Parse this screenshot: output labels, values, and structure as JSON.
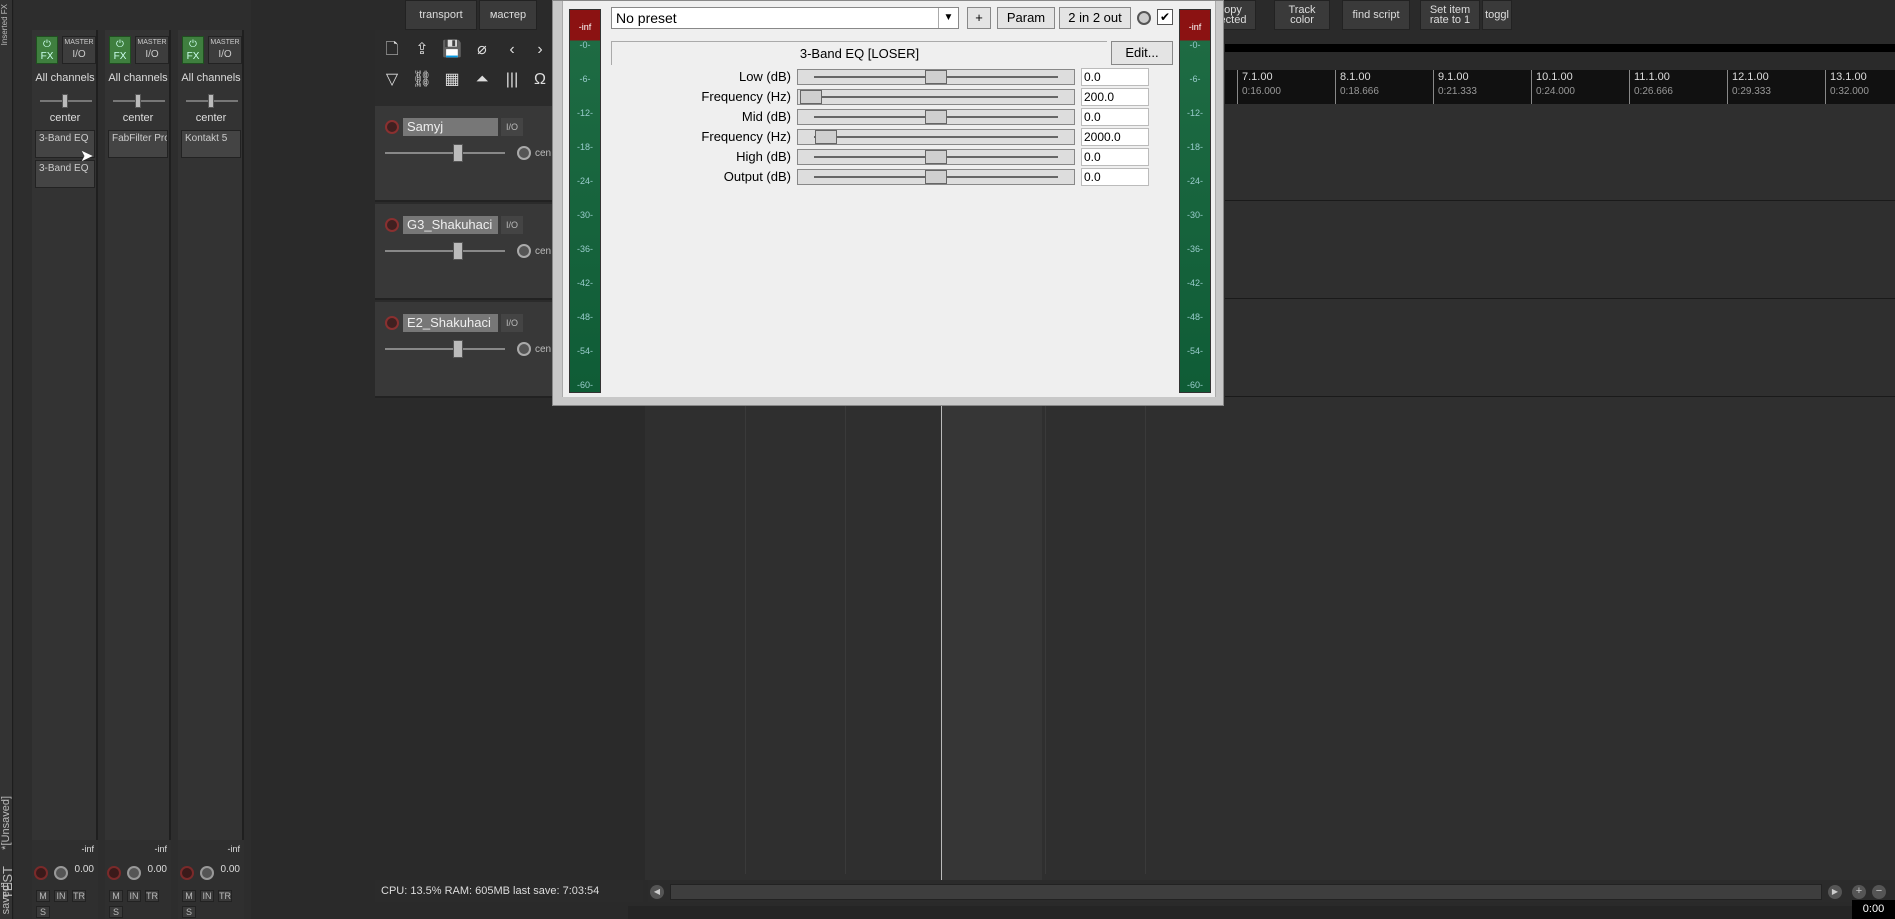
{
  "dock": {
    "top_label": "Inserted FX",
    "tabs": [
      "*[Unsaved]",
      "TEST",
      "saved]"
    ]
  },
  "mixer": {
    "strips": [
      {
        "fx": "FX",
        "master": "MASTER",
        "io": "I/O",
        "channels": "All channels",
        "pan": "center",
        "fx_slots": [
          "3-Band EQ",
          "3-Band EQ"
        ],
        "peak": "-inf",
        "volume": "0.00"
      },
      {
        "fx": "FX",
        "master": "MASTER",
        "io": "I/O",
        "channels": "All channels",
        "pan": "center",
        "fx_slots": [
          "FabFilter Pro"
        ],
        "peak": "-inf",
        "volume": "0.00"
      },
      {
        "fx": "FX",
        "master": "MASTER",
        "io": "I/O",
        "channels": "All channels",
        "pan": "center",
        "fx_slots": [
          "Kontakt 5"
        ],
        "peak": "-inf",
        "volume": "0.00"
      }
    ],
    "small_btns": {
      "mute": "M",
      "solo": "S",
      "in": "IN",
      "tr": "TR"
    }
  },
  "toolbar": {
    "transport": "transport",
    "master": "мастер",
    "copy_selected": "opy\nected",
    "track_color": "Track\ncolor",
    "find_script": "find script",
    "set_item_rate": "Set item\nrate to 1",
    "toggle": "toggl"
  },
  "tracks": [
    {
      "name": "Samyj",
      "io": "I/O",
      "pan": "cen"
    },
    {
      "name": "G3_Shakuhaci",
      "io": "I/O",
      "pan": "cen"
    },
    {
      "name": "E2_Shakuhaci",
      "io": "I/O",
      "pan": "cen"
    }
  ],
  "ruler": [
    {
      "bar": "7.1.00",
      "time": "0:16.000"
    },
    {
      "bar": "8.1.00",
      "time": "0:18.666"
    },
    {
      "bar": "9.1.00",
      "time": "0:21.333"
    },
    {
      "bar": "10.1.00",
      "time": "0:24.000"
    },
    {
      "bar": "11.1.00",
      "time": "0:26.666"
    },
    {
      "bar": "12.1.00",
      "time": "0:29.333"
    },
    {
      "bar": "13.1.00",
      "time": "0:32.000"
    }
  ],
  "status": "CPU: 13.5%  RAM: 605MB  last save: 7:03:54",
  "clock": "0:00",
  "fx_window": {
    "preset": "No preset",
    "plus": "+",
    "param": "Param",
    "routing": "2 in 2 out",
    "plugin_name": "3-Band EQ [LOSER]",
    "edit": "Edit...",
    "params": [
      {
        "label": "Low (dB)",
        "value": "0.0",
        "pos": 0.5
      },
      {
        "label": "Frequency (Hz)",
        "value": "200.0",
        "pos": 0.0
      },
      {
        "label": "Mid (dB)",
        "value": "0.0",
        "pos": 0.5
      },
      {
        "label": "Frequency (Hz)",
        "value": "2000.0",
        "pos": 0.06
      },
      {
        "label": "High (dB)",
        "value": "0.0",
        "pos": 0.5
      },
      {
        "label": "Output (dB)",
        "value": "0.0",
        "pos": 0.5
      }
    ],
    "meter_labels": [
      "-inf",
      "-0-",
      "-6-",
      "-12-",
      "-18-",
      "-24-",
      "-30-",
      "-36-",
      "-42-",
      "-48-",
      "-54-",
      "-60-"
    ]
  }
}
